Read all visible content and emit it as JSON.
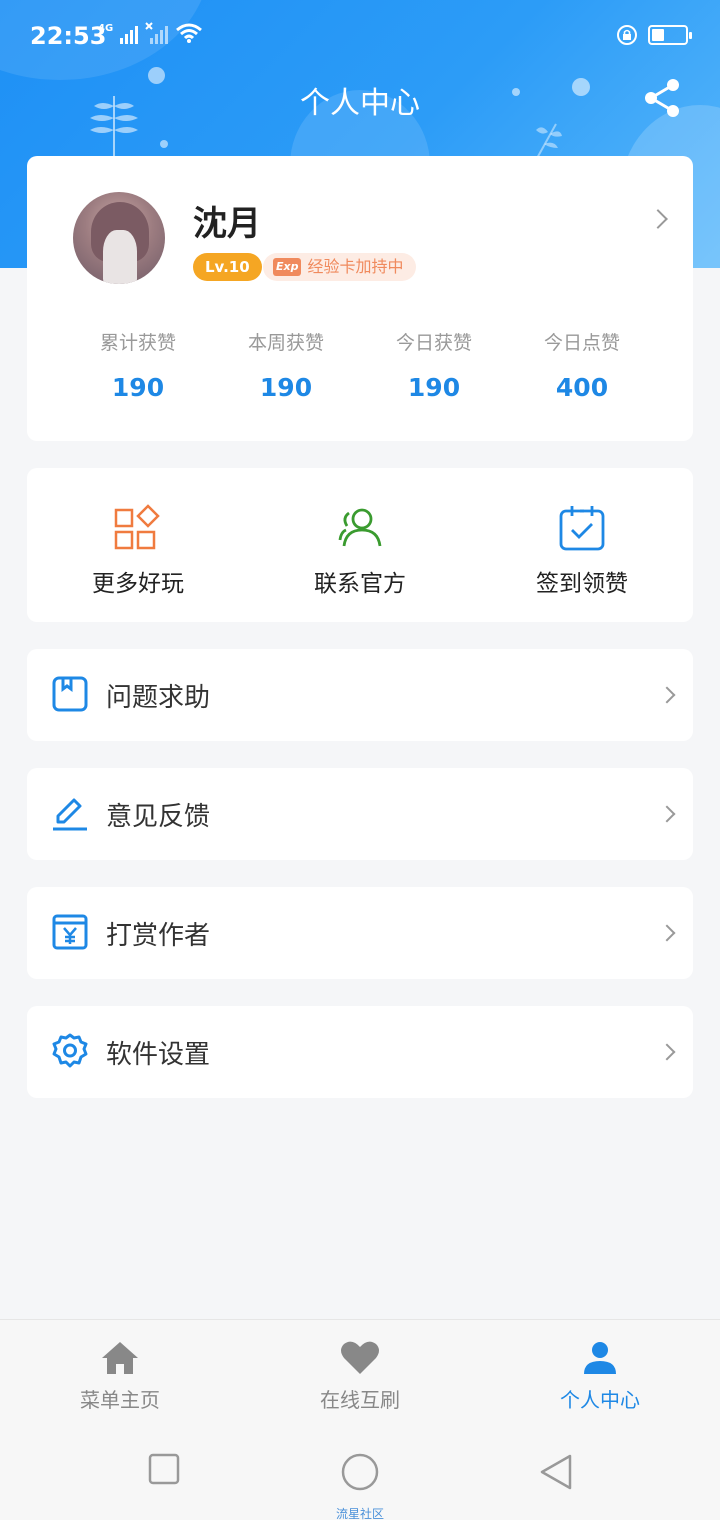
{
  "status_bar": {
    "time": "22:53",
    "network": "4G"
  },
  "header": {
    "title": "个人中心"
  },
  "profile": {
    "name": "沈月",
    "level": "Lv.10",
    "exp_icon": "Exp",
    "exp_text": "经验卡加持中",
    "stats": [
      {
        "label": "累计获赞",
        "value": "190"
      },
      {
        "label": "本周获赞",
        "value": "190"
      },
      {
        "label": "今日获赞",
        "value": "190"
      },
      {
        "label": "今日点赞",
        "value": "400"
      }
    ]
  },
  "tools": [
    {
      "label": "更多好玩",
      "icon": "grid-diamond-icon",
      "color": "#f07b3f"
    },
    {
      "label": "联系官方",
      "icon": "users-icon",
      "color": "#3a9b2f"
    },
    {
      "label": "签到领赞",
      "icon": "calendar-check-icon",
      "color": "#1e88e5"
    }
  ],
  "menu": [
    {
      "label": "问题求助",
      "icon": "help-book-icon"
    },
    {
      "label": "意见反馈",
      "icon": "edit-pen-icon"
    },
    {
      "label": "打赏作者",
      "icon": "yen-icon"
    },
    {
      "label": "软件设置",
      "icon": "gear-icon"
    }
  ],
  "tabs": [
    {
      "label": "菜单主页",
      "icon": "home-icon"
    },
    {
      "label": "在线互刷",
      "icon": "heart-icon"
    },
    {
      "label": "个人中心",
      "icon": "user-icon",
      "active": true
    }
  ],
  "watermark": "流星社区",
  "colors": {
    "accent": "#1e88e5",
    "header": "#2c9cf7",
    "level": "#f5a623"
  }
}
